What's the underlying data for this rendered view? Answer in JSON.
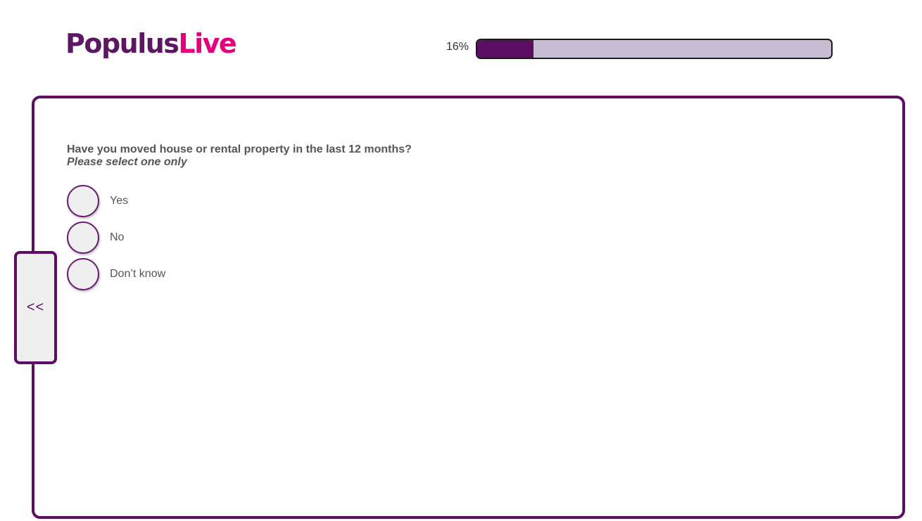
{
  "brand": {
    "logo_part_a": "Populus",
    "logo_part_b": "Live",
    "colors": {
      "primary": "#5c0e63",
      "accent": "#e6007e"
    }
  },
  "progress": {
    "label": "16%",
    "value_percent": 16
  },
  "question": {
    "title": "Have you moved house or rental property in the last 12 months?",
    "instruction": "Please select one only",
    "options": [
      {
        "label": "Yes"
      },
      {
        "label": "No"
      },
      {
        "label": "Don’t know"
      }
    ]
  },
  "navigation": {
    "back_label": "<<"
  }
}
